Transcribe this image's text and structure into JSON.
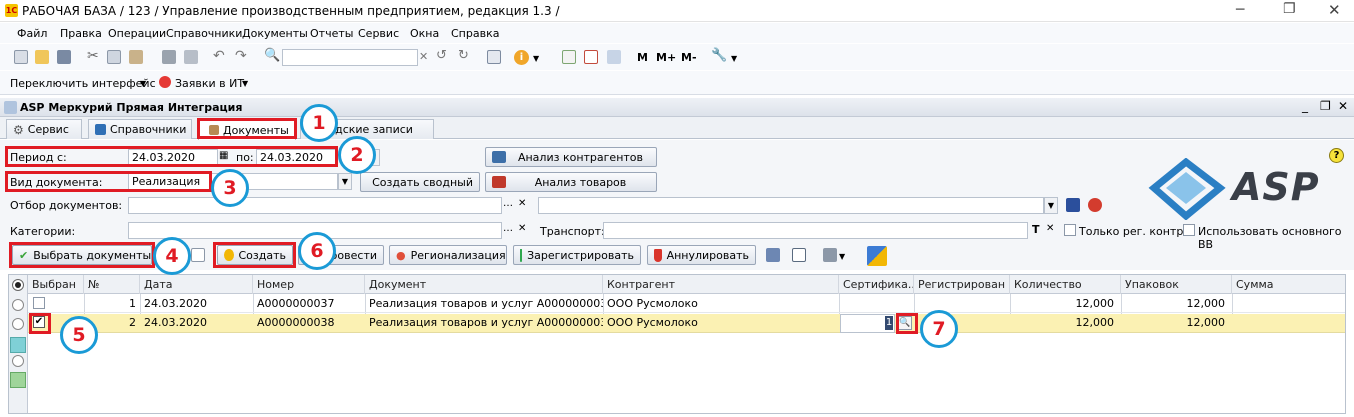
{
  "window": {
    "title": "РАБОЧАЯ БАЗА / 123 /  Управление производственным предприятием, редакция 1.3 /"
  },
  "menu": [
    "Файл",
    "Правка",
    "Операции",
    "Справочники",
    "Документы",
    "Отчеты",
    "Сервис",
    "Окна",
    "Справка"
  ],
  "toolbar": {
    "m": "M",
    "mplus": "M+",
    "mminus": "M-"
  },
  "toolbar2": {
    "switch_interface": "Переключить интерфейс",
    "it_requests": "Заявки в ИТ"
  },
  "subwindow": {
    "title": "ASP Меркурий Прямая Интеграция"
  },
  "tabs": [
    {
      "label": "Сервис"
    },
    {
      "label": "Справочники"
    },
    {
      "label": "Документы"
    },
    {
      "label": "Складские записи"
    }
  ],
  "filters": {
    "period_label": "Период с:",
    "date_from": "24.03.2020",
    "to_label": "по:",
    "date_to": "24.03.2020",
    "doc_type_label": "Вид документа:",
    "doc_type_value": "Реализация",
    "doc_filter_label": "Отбор документов:",
    "categories_label": "Категории:",
    "transport_label": "Транспорт:",
    "t_label": "T",
    "only_reg_label": "Только рег. контр",
    "use_main_label": "Использовать основного ВВ"
  },
  "buttons": {
    "analysis_contractors": "Анализ контрагентов",
    "create_summary": "Создать сводный",
    "analysis_goods": "Анализ товаров",
    "select_docs": "Выбрать документы",
    "create": "Создать",
    "post": "Провести",
    "regionalize": "Регионализация",
    "register": "Зарегистрировать",
    "annul": "Аннулировать"
  },
  "logo": {
    "text": "ASP"
  },
  "table": {
    "columns": [
      "Выбран",
      "№",
      "Дата",
      "Номер",
      "Документ",
      "Контрагент",
      "Сертифика...",
      "Регистрирован",
      "Количество",
      "Упаковок",
      "Сумма"
    ],
    "rows": [
      {
        "checked": false,
        "num": "1",
        "date": "24.03.2020",
        "number": "А0000000037",
        "doc": "Реализация товаров и услуг А0000000037 ...",
        "contractor": "ООО Русмолоко",
        "cert": "",
        "registered": "",
        "qty": "12,000",
        "packs": "12,000",
        "sum": ""
      },
      {
        "checked": true,
        "num": "2",
        "date": "24.03.2020",
        "number": "А0000000038",
        "doc": "Реализация товаров и услуг А0000000038 ...",
        "contractor": "ООО Русмолоко",
        "cert": "1",
        "registered": "",
        "qty": "12,000",
        "packs": "12,000",
        "sum": ""
      }
    ]
  },
  "annotations": [
    "1",
    "2",
    "3",
    "4",
    "5",
    "6",
    "7"
  ],
  "colors": {
    "accent_red": "#e01b24",
    "circle_blue": "#1a9ad6",
    "selected_row": "#fbf1b3",
    "logo_blue": "#2a7fc4"
  }
}
